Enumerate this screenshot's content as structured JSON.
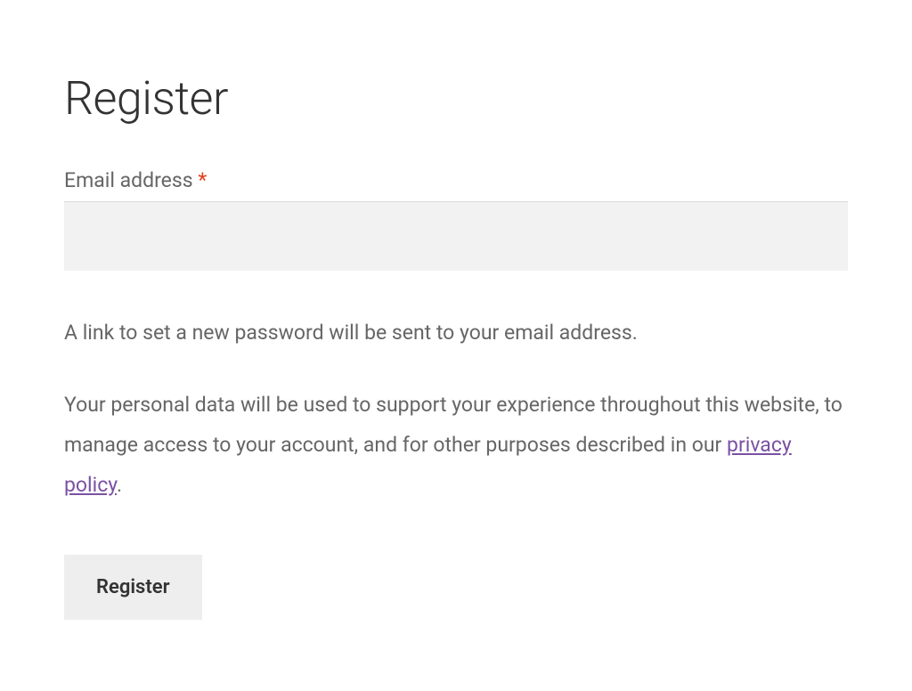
{
  "title": "Register",
  "form": {
    "email": {
      "label": "Email address",
      "required_marker": "*",
      "value": ""
    }
  },
  "info_text": "A link to set a new password will be sent to your email address.",
  "privacy": {
    "prefix": "Your personal data will be used to support your experience throughout this website, to manage access to your account, and for other purposes described in our ",
    "link_text": "privacy policy",
    "suffix": "."
  },
  "submit_label": "Register"
}
